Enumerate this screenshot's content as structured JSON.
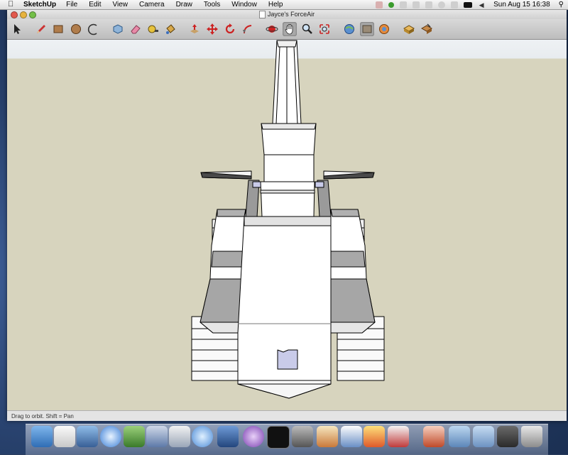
{
  "menubar": {
    "apple": "",
    "app_name": "SketchUp",
    "menus": [
      "File",
      "Edit",
      "View",
      "Camera",
      "Draw",
      "Tools",
      "Window",
      "Help"
    ],
    "clock": "Sun Aug 15  16:38"
  },
  "window": {
    "title": "Jayce's ForceAir"
  },
  "toolbar": {
    "tools": [
      "select-icon",
      "pencil-icon",
      "rectangle-icon",
      "circle-icon",
      "arc-icon",
      "make-component-icon",
      "eraser-icon",
      "tape-measure-icon",
      "paint-bucket-icon",
      "push-pull-icon",
      "move-icon",
      "rotate-icon",
      "follow-me-icon",
      "orbit-icon",
      "pan-icon",
      "zoom-icon",
      "zoom-extents-icon",
      "get-models-icon",
      "share-model-icon",
      "3d-warehouse-icon",
      "components-icon",
      "materials-icon"
    ],
    "active_tool": "pan-icon"
  },
  "statusbar": {
    "text": "Drag to orbit.  Shift = Pan"
  },
  "dock": {
    "apps": [
      "finder-icon",
      "preview-icon",
      "mail-icon",
      "safari-icon",
      "iphoto-icon",
      "itunes-icon",
      "xcode-icon",
      "network-icon",
      "system-preferences-icon",
      "podcast-icon",
      "terminal-icon",
      "sketchup-icon",
      "photo-booth-icon",
      "office-icon",
      "sticky-icon",
      "trash-area-icons",
      "folder-icon",
      "trash-icon"
    ]
  },
  "colors": {
    "viewport_ground": "#d7d4be",
    "viewport_sky": "#eef1f4",
    "model_face": "#ffffff",
    "model_shade": "#a8a8a8",
    "model_accent": "#c9cbe9"
  }
}
